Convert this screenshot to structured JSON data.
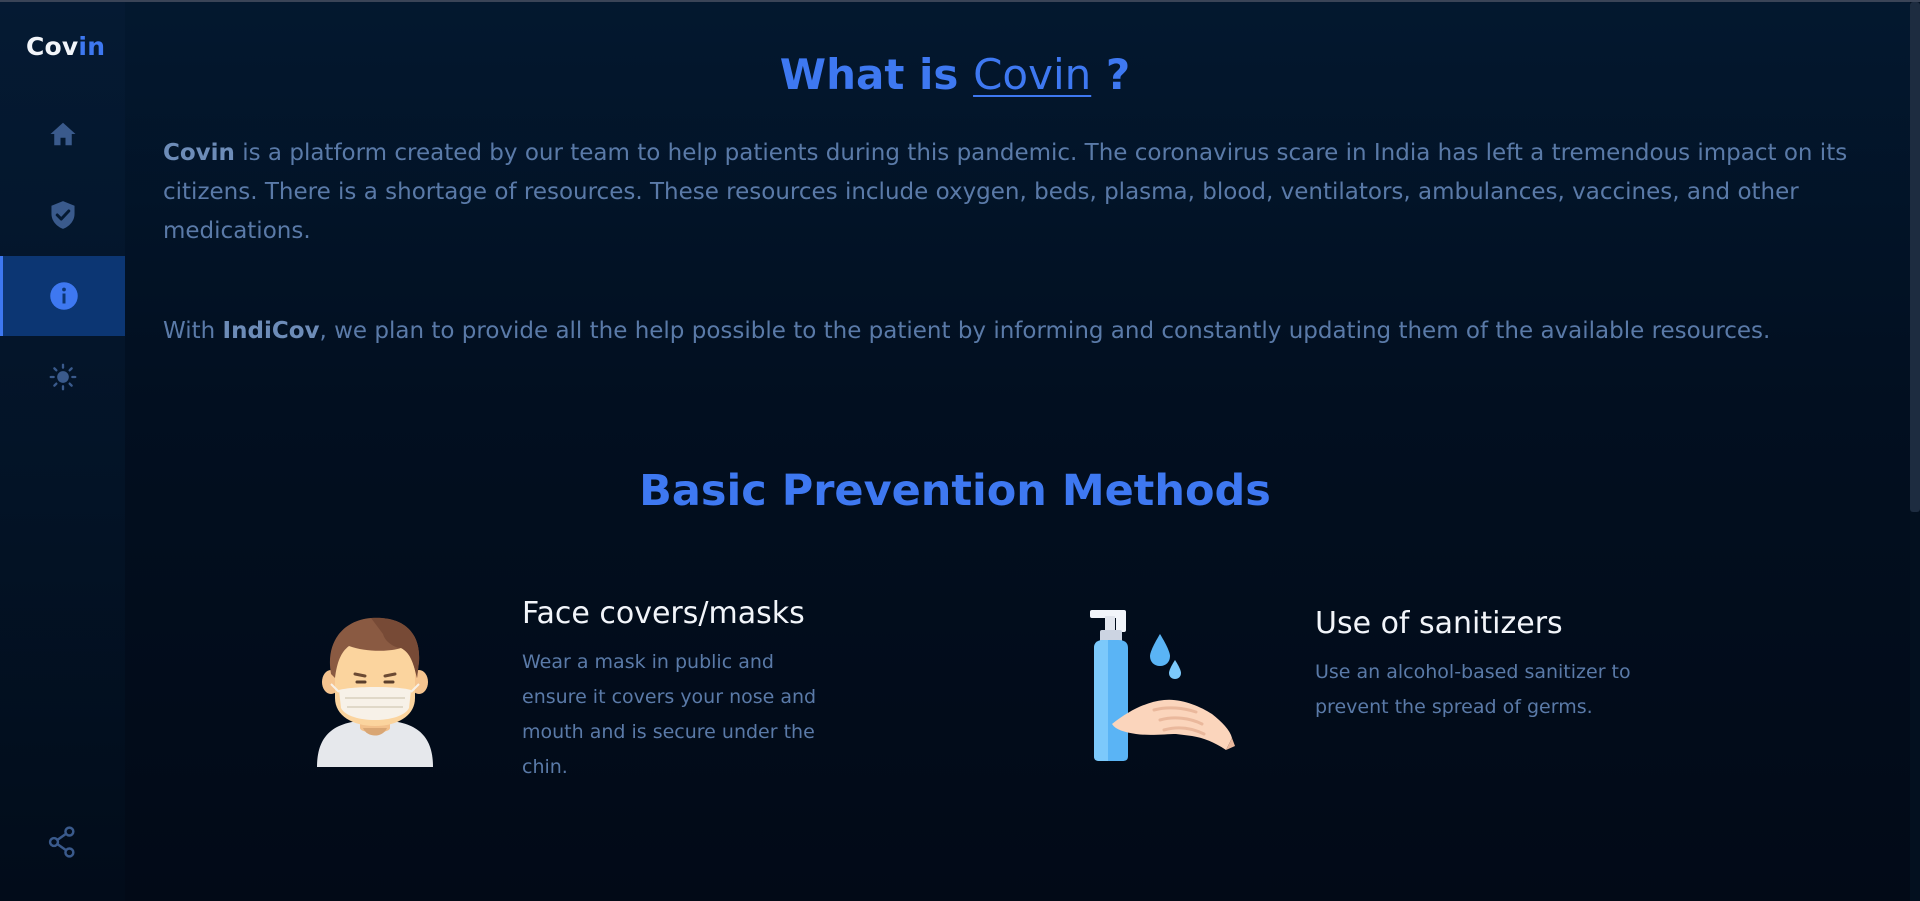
{
  "app": {
    "logo_part1": "Cov",
    "logo_part2": "in"
  },
  "sidebar": {
    "items": [
      {
        "name": "home",
        "icon": "home-icon",
        "active": false
      },
      {
        "name": "protection",
        "icon": "shield-check-icon",
        "active": false
      },
      {
        "name": "about",
        "icon": "info-icon",
        "active": true
      },
      {
        "name": "theme",
        "icon": "sun-icon",
        "active": false
      }
    ],
    "share_icon": "share-icon"
  },
  "about": {
    "title_prefix": "What is ",
    "title_link": "Covin",
    "title_suffix": " ?",
    "p1_bold": "Covin",
    "p1_rest": " is a platform created by our team to help patients during this pandemic. The coronavirus scare in India has left a tremendous impact on its citizens. There is a shortage of resources. These resources include oxygen, beds, plasma, blood, ventilators, ambulances, vaccines, and other medications.",
    "p2_start": "With ",
    "p2_bold": "IndiCov",
    "p2_rest": ", we plan to provide all the help possible to the patient by informing and constantly updating them of the available resources."
  },
  "prevention": {
    "title": "Basic Prevention Methods",
    "cards": [
      {
        "title": "Face covers/masks",
        "text": "Wear a mask in public and ensure it covers your nose and mouth and is secure under the chin.",
        "icon": "face-mask-icon"
      },
      {
        "title": "Use of sanitizers",
        "text": "Use an alcohol-based sanitizer to prevent the spread of germs.",
        "icon": "sanitizer-icon"
      }
    ]
  },
  "colors": {
    "accent": "#3e78f1",
    "background": "#03182f",
    "muted_text": "#5a7aa8",
    "active_nav": "#0c3673"
  }
}
